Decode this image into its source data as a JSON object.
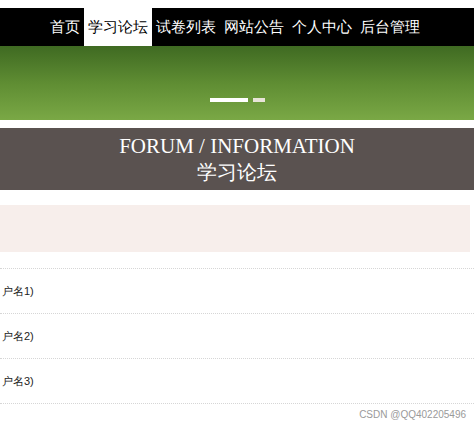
{
  "nav": {
    "items": [
      {
        "label": "首页",
        "selected": false
      },
      {
        "label": "学习论坛",
        "selected": true
      },
      {
        "label": "试卷列表",
        "selected": false
      },
      {
        "label": "网站公告",
        "selected": false
      },
      {
        "label": "个人中心",
        "selected": false
      },
      {
        "label": "后台管理",
        "selected": false
      }
    ]
  },
  "banner": {
    "indicators": [
      {
        "selected": true
      },
      {
        "selected": false
      }
    ]
  },
  "section": {
    "title_en": "FORUM / INFORMATION",
    "title_zh": "学习论坛"
  },
  "posts": [
    {
      "author": "户名1)"
    },
    {
      "author": "户名2)"
    },
    {
      "author": "户名3)"
    }
  ],
  "watermark": "CSDN @QQ402205496"
}
